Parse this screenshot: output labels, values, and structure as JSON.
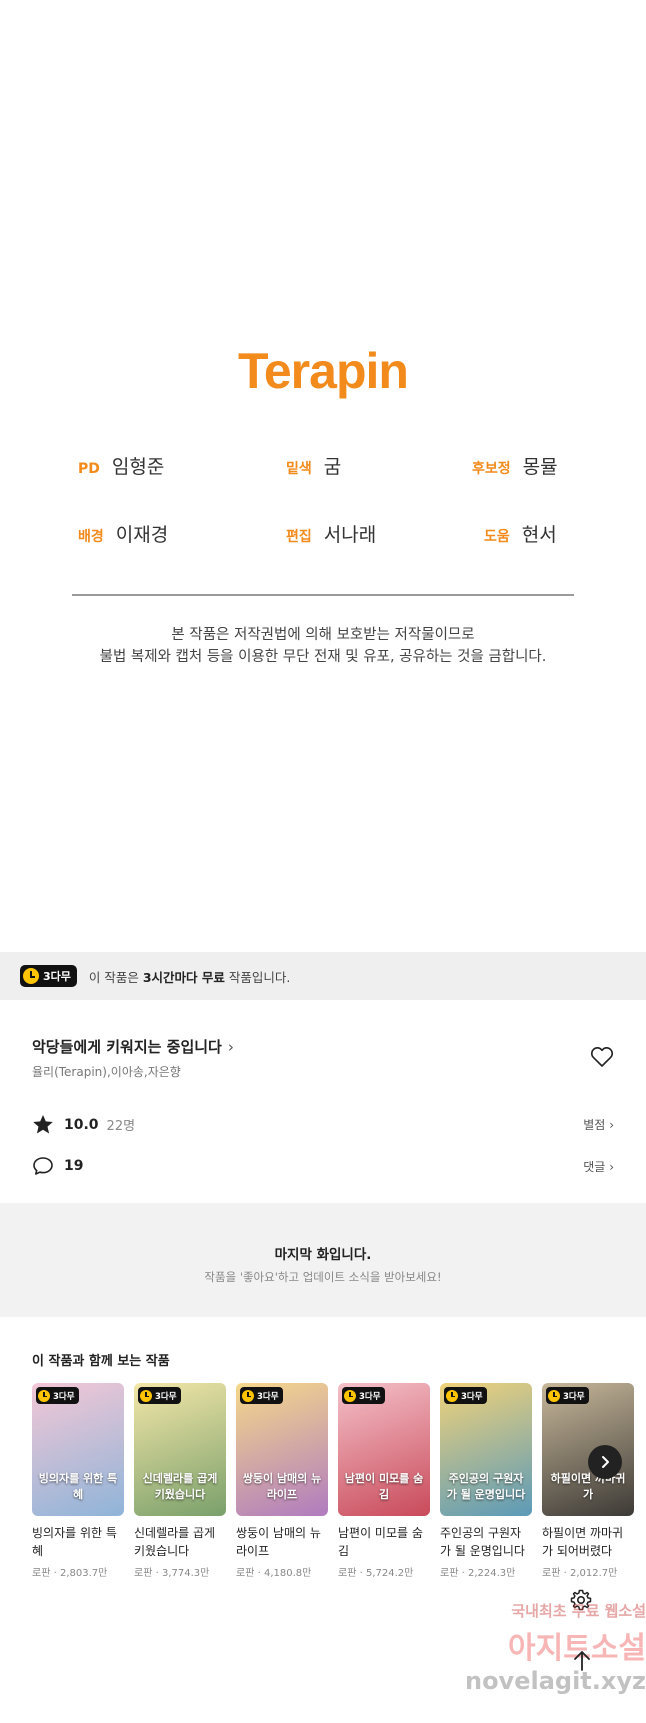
{
  "credits": {
    "logo": "Terapin",
    "items": [
      {
        "role": "PD",
        "name": "임형준"
      },
      {
        "role": "밑색",
        "name": "굼"
      },
      {
        "role": "후보정",
        "name": "몽뮬"
      },
      {
        "role": "배경",
        "name": "이재경"
      },
      {
        "role": "편집",
        "name": "서나래"
      },
      {
        "role": "도움",
        "name": "현서"
      }
    ],
    "notice_line1": "본 작품은 저작권법에 의해 보호받는 저작물이므로",
    "notice_line2": "불법 복제와 캡처 등을 이용한 무단 전재 및 유포, 공유하는 것을 금합니다."
  },
  "free_bar": {
    "badge": "3다무",
    "text_prefix": "이 작품은 ",
    "text_bold": "3시간마다 무료",
    "text_suffix": " 작품입니다."
  },
  "work": {
    "title": "악당들에게 키워지는 중입니다",
    "authors": "율리(Terapin),이아송,자은향",
    "rating": "10.0",
    "rating_count": "22명",
    "rate_label": "별점",
    "comment_count": "19",
    "comment_label": "댓글"
  },
  "last_episode": {
    "title": "마지막 화입니다.",
    "subtitle": "작품을 '좋아요'하고 업데이트 소식을 받아보세요!"
  },
  "recommend": {
    "heading": "이 작품과 함께 보는 작품",
    "badge": "3다무",
    "items": [
      {
        "name": "빙의자를 위한 특혜",
        "genre": "로판",
        "views": "2,803.7만",
        "cover_text": "빙의자를 위한 특혜",
        "color1": "#f3c7d6",
        "color2": "#8fb4d8"
      },
      {
        "name": "신데렐라를 곱게 키웠습니다",
        "genre": "로판",
        "views": "3,774.3만",
        "cover_text": "신데렐라를 곱게 키웠습니다",
        "color1": "#f3e6a8",
        "color2": "#7aa06b"
      },
      {
        "name": "쌍둥이 남매의 뉴라이프",
        "genre": "로판",
        "views": "4,180.8만",
        "cover_text": "쌍둥이 남매의 뉴 라이프",
        "color1": "#f6d88a",
        "color2": "#b07bbf"
      },
      {
        "name": "남편이 미모를 숨김",
        "genre": "로판",
        "views": "5,724.2만",
        "cover_text": "남편이 미모를 숨김",
        "color1": "#f4c1c9",
        "color2": "#c94a5a"
      },
      {
        "name": "주인공의 구원자가 될 운명입니다",
        "genre": "로판",
        "views": "2,224.3만",
        "cover_text": "주인공의 구원자가 될 운명입니다",
        "color1": "#f0d27a",
        "color2": "#5b9ab8"
      },
      {
        "name": "하필이면 까마귀가 되어버렸다",
        "genre": "로판",
        "views": "2,012.7만",
        "cover_text": "하필이면 까마귀가",
        "color1": "#c7b79a",
        "color2": "#3d3a36"
      }
    ]
  },
  "watermark": {
    "line1": "국내최초 무료 웹소설",
    "line2": "아지트소설",
    "line3": "novelagit.xyz"
  },
  "icons": {
    "heart": "heart-icon",
    "star": "star-icon",
    "comment": "comment-icon",
    "next": "chevron-right-icon",
    "settings": "gear-icon",
    "top": "arrow-up-icon"
  },
  "colors": {
    "accent": "#F28A1C",
    "badge_bg": "#111111",
    "badge_clock": "#FFC400"
  }
}
